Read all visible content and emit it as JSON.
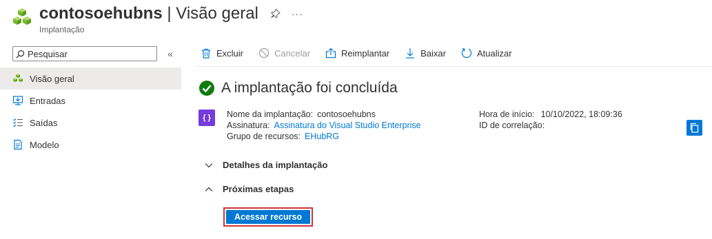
{
  "header": {
    "resource_name": "contosoehubns",
    "separator": " | ",
    "page_name": "Visão geral",
    "subtitle": "Implantação",
    "pin_icon": "pin-icon",
    "more_label": "···",
    "icon": "event-hubs-cubes-icon"
  },
  "sidebar": {
    "search": {
      "placeholder": "Pesquisar",
      "value": ""
    },
    "collapse_label": "«",
    "items": [
      {
        "label": "Visão geral",
        "icon": "overview-icon",
        "active": true
      },
      {
        "label": "Entradas",
        "icon": "inputs-icon",
        "active": false
      },
      {
        "label": "Saídas",
        "icon": "outputs-icon",
        "active": false
      },
      {
        "label": "Modelo",
        "icon": "template-icon",
        "active": false
      }
    ]
  },
  "toolbar": {
    "items": [
      {
        "label": "Excluir",
        "icon": "trash-icon",
        "enabled": true
      },
      {
        "label": "Cancelar",
        "icon": "cancel-icon",
        "enabled": false
      },
      {
        "label": "Reimplantar",
        "icon": "redeploy-icon",
        "enabled": true
      },
      {
        "label": "Baixar",
        "icon": "download-icon",
        "enabled": true
      },
      {
        "label": "Atualizar",
        "icon": "refresh-icon",
        "enabled": true
      }
    ]
  },
  "main": {
    "status_title": "A implantação foi concluída",
    "deployment": {
      "name_label": "Nome da implantação:",
      "name_value": "contosoehubns",
      "subscription_label": "Assinatura:",
      "subscription_value": "Assinatura do Visual Studio Enterprise",
      "resource_group_label": "Grupo de recursos:",
      "resource_group_value": "EHubRG",
      "start_time_label": "Hora de início:",
      "start_time_value": "10/10/2022, 18:09:36",
      "correlation_label": "ID de correlação:",
      "correlation_value": ""
    },
    "sections": {
      "details": "Detalhes da implantação",
      "next_steps": "Próximas etapas"
    },
    "go_button": "Acessar recurso"
  },
  "colors": {
    "accent": "#0078d4",
    "success": "#107c10",
    "highlight_border": "#d13438",
    "deployment_icon": "#773adc",
    "active_nav": "#edebe9"
  }
}
